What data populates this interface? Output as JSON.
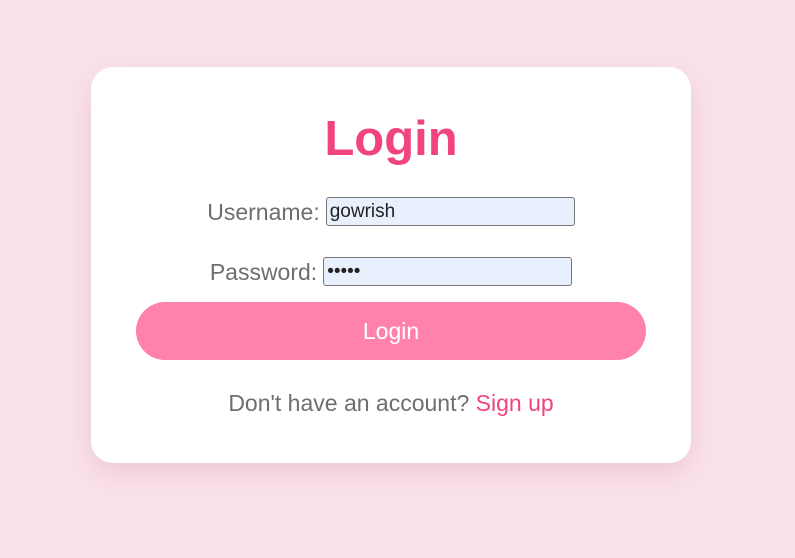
{
  "login_form": {
    "title": "Login",
    "username": {
      "label": "Username:",
      "value": "gowrish"
    },
    "password": {
      "label": "Password:",
      "value": "12345"
    },
    "submit_label": "Login",
    "signup_prompt": "Don't have an account?",
    "signup_link": "Sign up"
  },
  "colors": {
    "background": "#fbe3ea",
    "card": "#ffffff",
    "accent": "#f0437f",
    "button": "#ff82ab",
    "input_fill": "#e8f0fe"
  }
}
